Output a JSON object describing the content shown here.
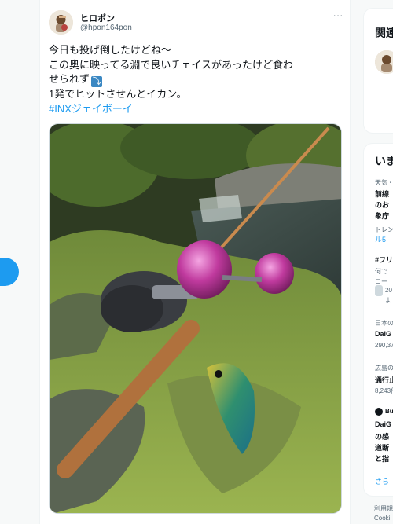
{
  "tweet": {
    "display_name": "ヒロポン",
    "handle": "@hpon164pon",
    "more_icon": "more-icon",
    "text_lines": [
      "今日も投げ倒したけどね〜",
      "この奥に映ってる淵で良いチェイスがあったけど食わ",
      "せられず",
      "1発でヒットさせんとイカン。"
    ],
    "emoji": "⤵",
    "hashtag": "#INXジェイボーイ"
  },
  "right_sidebar": {
    "heading_top": "関連",
    "heading_trends": "いま",
    "items": [
      {
        "text": "天気・",
        "style": "small"
      },
      {
        "text": "前線",
        "style": "bold"
      },
      {
        "text": "のお",
        "style": "bold"
      },
      {
        "text": "象庁",
        "style": "bold"
      },
      {
        "text": "トレン",
        "style": "small"
      },
      {
        "text": "ル5",
        "style": "blue"
      },
      {
        "text": "#フリ",
        "style": "bold"
      },
      {
        "text": "何で",
        "style": "small"
      },
      {
        "text": "ロー",
        "style": "small"
      },
      {
        "text": "20",
        "style": "small"
      },
      {
        "text": "よ",
        "style": "small"
      },
      {
        "text": "日本の",
        "style": "small"
      },
      {
        "text": "DaiG",
        "style": "bold"
      },
      {
        "text": "290,37",
        "style": "small"
      },
      {
        "text": "広島の",
        "style": "small"
      },
      {
        "text": "通行止",
        "style": "bold"
      },
      {
        "text": "8,243件",
        "style": "small"
      },
      {
        "text": "Bu",
        "style": "bold"
      },
      {
        "text": "DaiG",
        "style": "bold"
      },
      {
        "text": "の感",
        "style": "bold"
      },
      {
        "text": "道断",
        "style": "bold"
      },
      {
        "text": "と指",
        "style": "bold"
      },
      {
        "text": "さら",
        "style": "blue"
      },
      {
        "text": "利用規",
        "style": "small"
      },
      {
        "text": "Cooki",
        "style": "small"
      }
    ]
  },
  "colors": {
    "accent": "#1d9bf0",
    "text": "#0f1419",
    "secondary_text": "#536471",
    "lure_pink": "#c03a9e"
  }
}
